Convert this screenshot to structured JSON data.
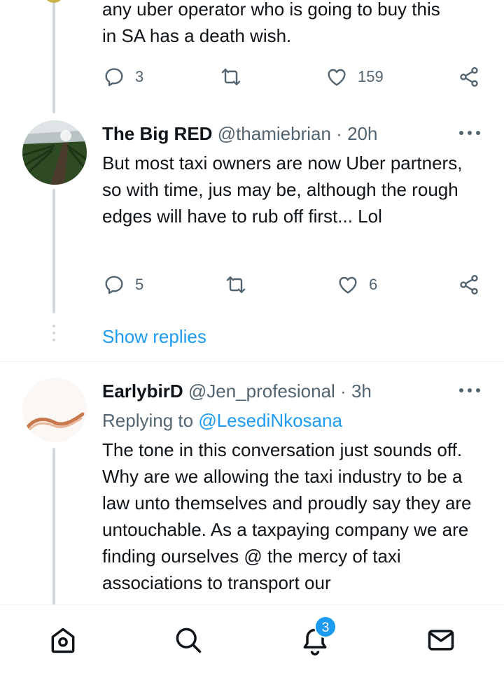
{
  "tweet0": {
    "text_lines": [
      "any uber operator who is going to buy this",
      "in SA has a death wish."
    ],
    "replies": "3",
    "likes": "159"
  },
  "tweet1": {
    "name": "The Big RED",
    "handle": "@thamiebrian",
    "sep": "·",
    "time": "20h",
    "text": "But most taxi owners are now Uber partners, so with time, jus may be, although the rough edges will have to rub off first... Lol",
    "replies": "5",
    "likes": "6"
  },
  "show_replies_label": "Show replies",
  "tweet2": {
    "name": "EarlybirD",
    "handle": "@Jen_profesional",
    "sep": "·",
    "time": "3h",
    "replying_prefix": "Replying to",
    "replying_to": "@LesediNkosana",
    "text": "The tone in this conversation just sounds off. Why are we allowing the taxi industry to be a law unto themselves and proudly say they are untouchable. As a taxpaying company we are finding ourselves @ the mercy of taxi associations to transport our"
  },
  "nav": {
    "items": [
      "home-icon",
      "search-icon",
      "notifications-icon",
      "messages-icon"
    ],
    "notifications_badge": "3"
  },
  "colors": {
    "accent": "#1d9bf0",
    "text": "#0f1419",
    "muted": "#536471",
    "thread_line": "#cfd9de"
  }
}
